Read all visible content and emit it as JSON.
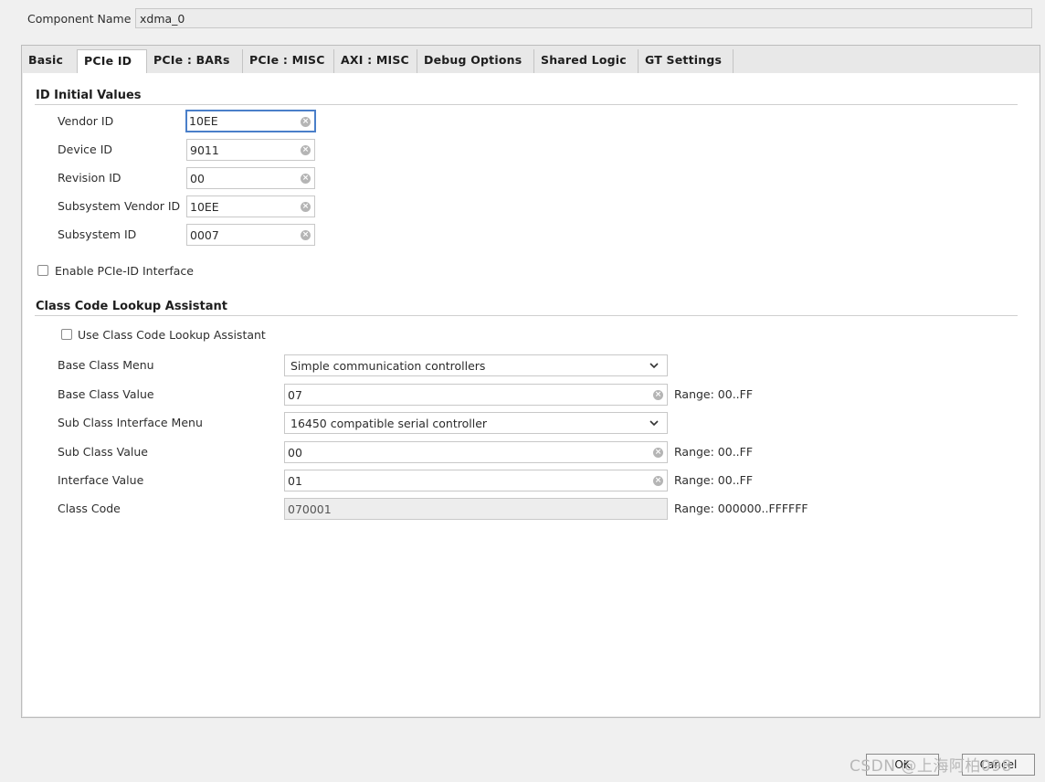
{
  "component": {
    "label": "Component Name",
    "value": "xdma_0"
  },
  "tabs": [
    {
      "label": "Basic"
    },
    {
      "label": "PCIe ID"
    },
    {
      "label": "PCIe : BARs"
    },
    {
      "label": "PCIe : MISC"
    },
    {
      "label": "AXI : MISC"
    },
    {
      "label": "Debug Options"
    },
    {
      "label": "Shared Logic"
    },
    {
      "label": "GT Settings"
    }
  ],
  "active_tab": "PCIe ID",
  "id_section": {
    "title": "ID Initial Values",
    "fields": [
      {
        "label": "Vendor ID",
        "value": "10EE"
      },
      {
        "label": "Device ID",
        "value": "9011"
      },
      {
        "label": "Revision ID",
        "value": "00"
      },
      {
        "label": "Subsystem Vendor ID",
        "value": "10EE"
      },
      {
        "label": "Subsystem ID",
        "value": "0007"
      }
    ],
    "enable_interface_label": "Enable PCIe-ID Interface",
    "enable_interface_checked": false
  },
  "class_section": {
    "title": "Class Code Lookup Assistant",
    "use_assistant_label": "Use Class Code Lookup Assistant",
    "use_assistant_checked": false,
    "base_class_menu": {
      "label": "Base Class Menu",
      "value": "Simple communication controllers"
    },
    "base_class_value": {
      "label": "Base Class Value",
      "value": "07",
      "range": "Range: 00..FF"
    },
    "sub_class_menu": {
      "label": "Sub Class Interface Menu",
      "value": "16450 compatible serial controller"
    },
    "sub_class_value": {
      "label": "Sub Class Value",
      "value": "00",
      "range": "Range: 00..FF"
    },
    "interface_value": {
      "label": "Interface Value",
      "value": "01",
      "range": "Range: 00..FF"
    },
    "class_code": {
      "label": "Class Code",
      "value": "070001",
      "range": "Range: 000000..FFFFFF"
    }
  },
  "buttons": {
    "ok": "OK",
    "cancel": "Cancel"
  },
  "watermark": "CSDN @上海阿柏098",
  "colors": {
    "focus_border": "#4a7fc9",
    "content_bg": "#ffffff",
    "window_bg": "#f0f0f0"
  }
}
